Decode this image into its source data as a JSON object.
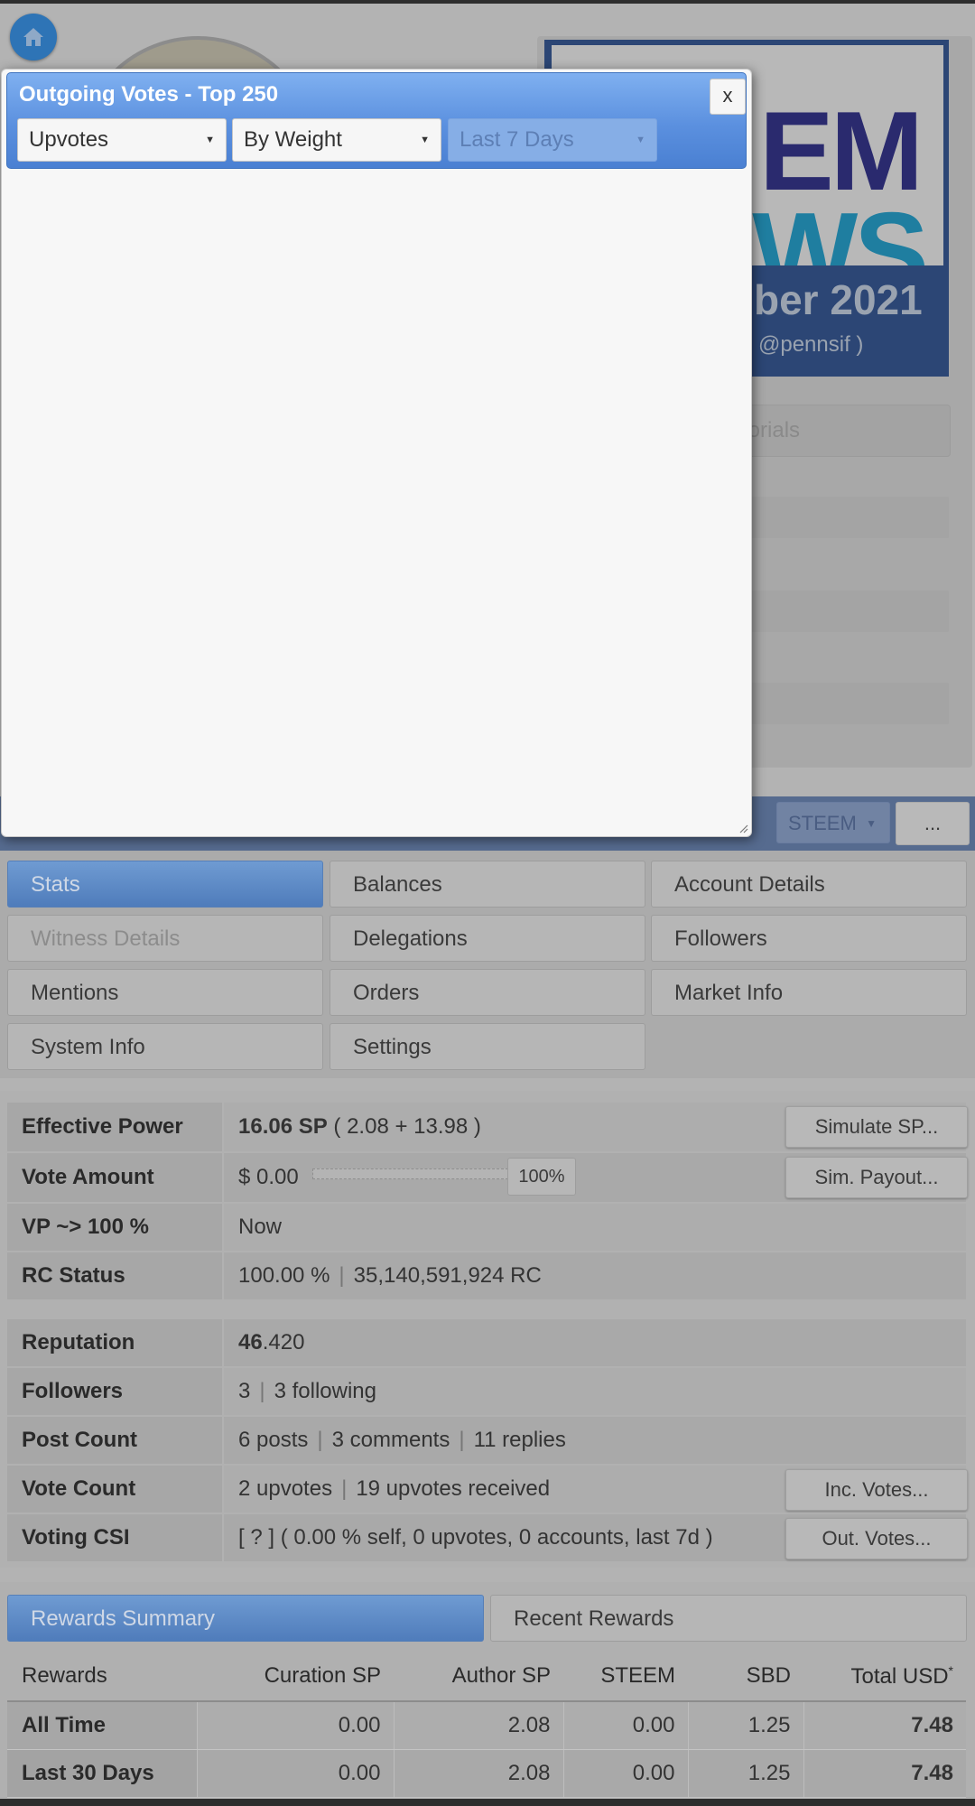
{
  "nav": {
    "home_icon": "home-icon"
  },
  "banner": {
    "word1": "EM",
    "word2": "WS",
    "date": "ber 2021",
    "user": "@pennsif )",
    "tutorials_label": "torials"
  },
  "toolbar": {
    "currency_select": "STEEM",
    "more_label": "..."
  },
  "dialog": {
    "title": "Outgoing Votes - Top 250",
    "close_label": "x",
    "filters": {
      "type": "Upvotes",
      "sort": "By Weight",
      "period": "Last 7 Days"
    }
  },
  "tabs": [
    {
      "label": "Stats",
      "active": true
    },
    {
      "label": "Balances"
    },
    {
      "label": "Account Details"
    },
    {
      "label": "Witness Details",
      "disabled": true
    },
    {
      "label": "Delegations"
    },
    {
      "label": "Followers"
    },
    {
      "label": "Mentions"
    },
    {
      "label": "Orders"
    },
    {
      "label": "Market Info"
    },
    {
      "label": "System Info"
    },
    {
      "label": "Settings"
    }
  ],
  "stats": {
    "effective_power": {
      "label": "Effective Power",
      "value_bold": "16.06 SP",
      "value_rest": "( 2.08 + 13.98 )",
      "button": "Simulate SP..."
    },
    "vote_amount": {
      "label": "Vote Amount",
      "value": "$ 0.00",
      "percent": "100%",
      "button": "Sim. Payout..."
    },
    "vp": {
      "label": "VP ~> 100 %",
      "value": "Now"
    },
    "rc_status": {
      "label": "RC Status",
      "percent": "100.00 %",
      "rc": "35,140,591,924 RC"
    },
    "reputation": {
      "label": "Reputation",
      "value_bold": "46",
      "value_rest": ".420"
    },
    "followers": {
      "label": "Followers",
      "followers": "3",
      "following": "3 following"
    },
    "post_count": {
      "label": "Post Count",
      "posts": "6 posts",
      "comments": "3 comments",
      "replies": "11 replies"
    },
    "vote_count": {
      "label": "Vote Count",
      "upvotes": "2 upvotes",
      "received": "19 upvotes received",
      "button": "Inc. Votes..."
    },
    "voting_csi": {
      "label": "Voting CSI",
      "value": "[ ? ] ( 0.00 % self, 0 upvotes, 0 accounts, last 7d )",
      "button": "Out. Votes..."
    }
  },
  "rewards": {
    "tabs": [
      "Rewards Summary",
      "Recent Rewards"
    ],
    "columns": [
      "Rewards",
      "Curation SP",
      "Author SP",
      "STEEM",
      "SBD",
      "Total USD"
    ],
    "total_marker": "*",
    "rows": [
      {
        "label": "All Time",
        "curation_sp": "0.00",
        "author_sp": "2.08",
        "steem": "0.00",
        "sbd": "1.25",
        "total_usd": "7.48"
      },
      {
        "label": "Last 30 Days",
        "curation_sp": "0.00",
        "author_sp": "2.08",
        "steem": "0.00",
        "sbd": "1.25",
        "total_usd": "7.48"
      }
    ]
  }
}
